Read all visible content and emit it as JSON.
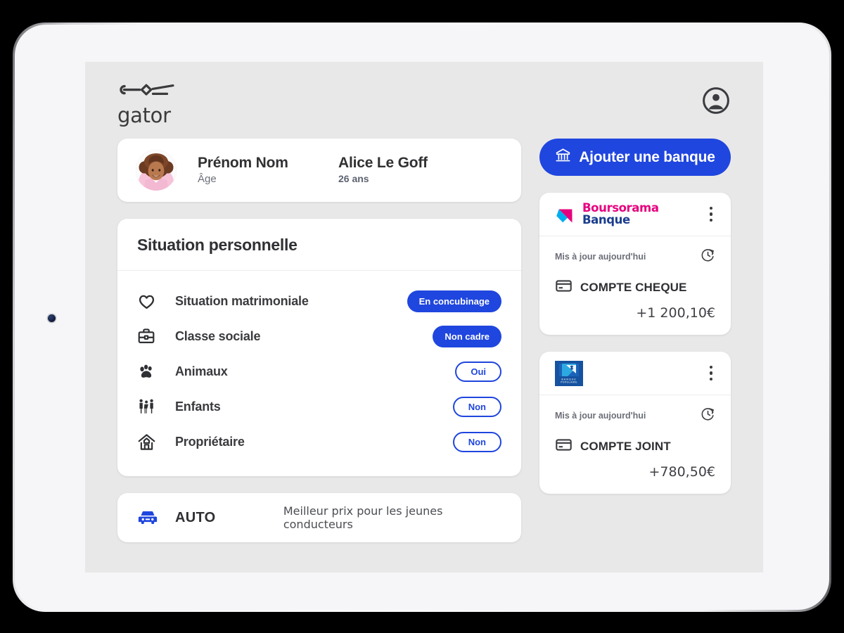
{
  "brand": {
    "word": "gator",
    "mark_icon": "gator-logo-mark"
  },
  "header": {
    "account_icon": "account-circle-icon"
  },
  "identity": {
    "label_name": "Prénom Nom",
    "label_age": "Âge",
    "value_name": "Alice Le Goff",
    "value_age": "26 ans",
    "avatar_icon": "user-avatar-photo"
  },
  "situation": {
    "title": "Situation personnelle",
    "rows": [
      {
        "icon": "heart-icon",
        "label": "Situation matrimoniale",
        "value": "En concubinage",
        "style": "filled"
      },
      {
        "icon": "briefcase-icon",
        "label": "Classe sociale",
        "value": "Non cadre",
        "style": "filled"
      },
      {
        "icon": "paw-icon",
        "label": "Animaux",
        "value": "Oui",
        "style": "outline"
      },
      {
        "icon": "family-icon",
        "label": "Enfants",
        "value": "Non",
        "style": "outline"
      },
      {
        "icon": "home-icon",
        "label": "Propriétaire",
        "value": "Non",
        "style": "outline"
      }
    ]
  },
  "auto": {
    "icon": "car-icon",
    "title": "AUTO",
    "subtitle": "Meilleur prix pour les jeunes conducteurs"
  },
  "add_bank": {
    "label": "Ajouter une banque",
    "icon": "bank-icon"
  },
  "banks": [
    {
      "logo_icon": "boursorama-logo",
      "logo_line1": "Boursorama",
      "logo_line2": "Banque",
      "menu_icon": "kebab-menu-icon",
      "updated": "Mis à jour aujourd'hui",
      "refresh_icon": "clock-refresh-icon",
      "account_icon": "credit-card-icon",
      "account_name": "COMPTE CHEQUE",
      "amount": "+1 200,10€"
    },
    {
      "logo_icon": "banque-populaire-logo",
      "logo_line1": "BANQUE",
      "logo_line2": "POPULAIRE",
      "menu_icon": "kebab-menu-icon",
      "updated": "Mis à jour aujourd'hui",
      "refresh_icon": "clock-refresh-icon",
      "account_icon": "credit-card-icon",
      "account_name": "COMPTE JOINT",
      "amount": "+780,50€"
    }
  ],
  "colors": {
    "accent_blue": "#1f46de",
    "screen_bg": "#e8e8e8",
    "card_bg": "#ffffff",
    "text_dark": "#2f3033",
    "text_muted": "#6b6e77",
    "boursorama_magenta": "#e6007e",
    "boursorama_blue": "#1b3d8f",
    "banque_populaire_blue": "#1552a0"
  }
}
